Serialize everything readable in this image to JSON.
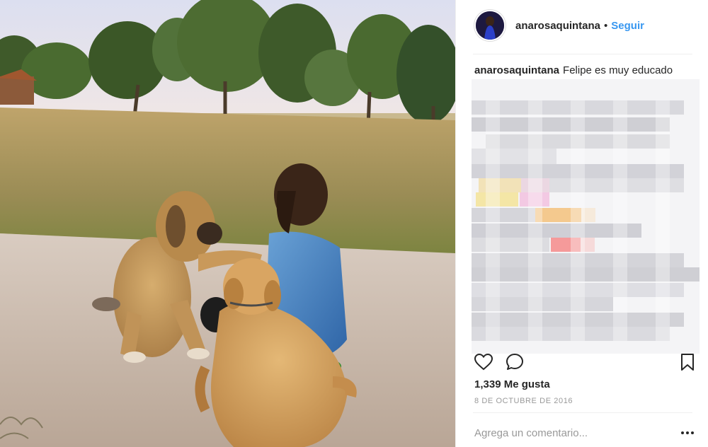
{
  "post": {
    "username": "anarosaquintana",
    "separator": "•",
    "follow_label": "Seguir",
    "caption_user": "anarosaquintana",
    "caption_text": "Felipe es muy educado",
    "likes": "1,339 Me gusta",
    "date": "8 DE OCTUBRE DE 2016",
    "comment_placeholder": "Agrega un comentario...",
    "more_label": "•••"
  },
  "icons": {
    "like": "heart-icon",
    "comment": "comment-bubble-icon",
    "save": "bookmark-icon",
    "more": "more-options-icon"
  },
  "colors": {
    "follow": "#3897f0",
    "text": "#262626",
    "muted": "#999999"
  }
}
